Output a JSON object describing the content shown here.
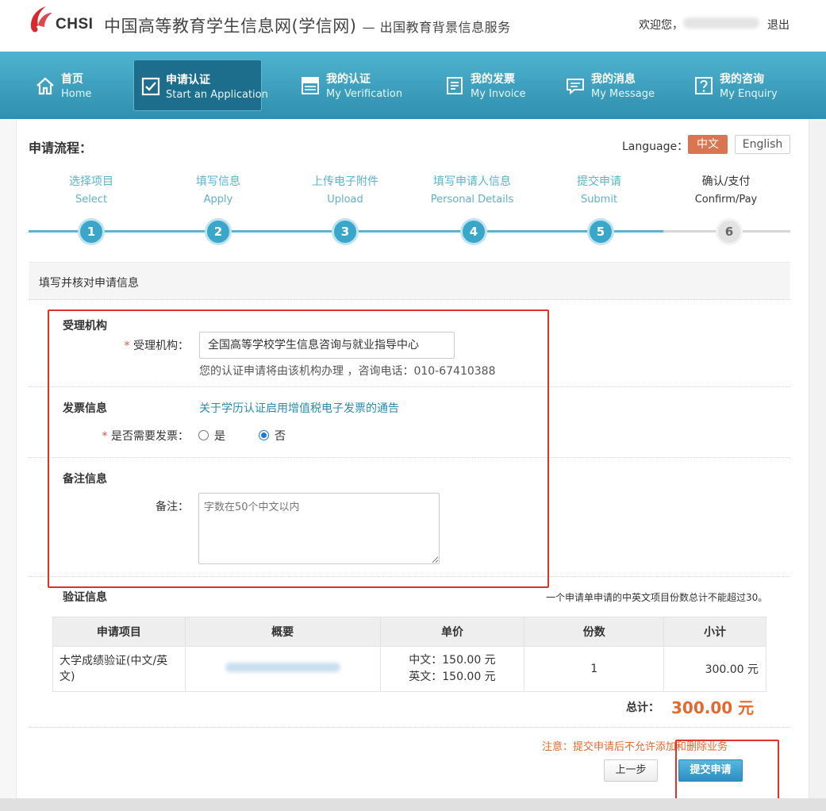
{
  "header": {
    "logo_text": "CHSI",
    "site_title": "中国高等教育学生信息网(学信网)",
    "site_subtitle": "— 出国教育背景信息服务",
    "welcome": "欢迎您，",
    "logout": "退出"
  },
  "nav": [
    {
      "zh": "首页",
      "en": "Home",
      "icon": "home-icon"
    },
    {
      "zh": "申请认证",
      "en": "Start an Application",
      "icon": "checkbox-icon",
      "active": true
    },
    {
      "zh": "我的认证",
      "en": "My Verification",
      "icon": "certificate-icon"
    },
    {
      "zh": "我的发票",
      "en": "My Invoice",
      "icon": "invoice-icon"
    },
    {
      "zh": "我的消息",
      "en": "My Message",
      "icon": "message-icon"
    },
    {
      "zh": "我的咨询",
      "en": "My Enquiry",
      "icon": "question-icon"
    }
  ],
  "process": {
    "title": "申请流程：",
    "language_label": "Language：",
    "lang_zh": "中文",
    "lang_en": "English",
    "steps": [
      {
        "zh": "选择项目",
        "en": "Select",
        "num": "1"
      },
      {
        "zh": "填写信息",
        "en": "Apply",
        "num": "2"
      },
      {
        "zh": "上传电子附件",
        "en": "Upload",
        "num": "3"
      },
      {
        "zh": "填写申请人信息",
        "en": "Personal Details",
        "num": "4"
      },
      {
        "zh": "提交申请",
        "en": "Submit",
        "num": "5"
      },
      {
        "zh": "确认/支付",
        "en": "Confirm/Pay",
        "num": "6"
      }
    ],
    "current_step": 6
  },
  "form": {
    "section_title": "填写并核对申请信息",
    "agency": {
      "title": "受理机构",
      "label": "受理机构：",
      "value": "全国高等学校学生信息咨询与就业指导中心",
      "hint": "您的认证申请将由该机构办理 ，咨询电话：010-67410388"
    },
    "invoice": {
      "title": "发票信息",
      "notice_link": "关于学历认证启用增值税电子发票的通告",
      "label": "是否需要发票：",
      "option_yes": "是",
      "option_no": "否",
      "selected": "否"
    },
    "remark": {
      "title": "备注信息",
      "label": "备注：",
      "placeholder": "字数在50个中文以内"
    }
  },
  "verification": {
    "title": "验证信息",
    "note": "一个申请单申请的中英文项目份数总计不能超过30。",
    "columns": [
      "申请项目",
      "概要",
      "单价",
      "份数",
      "小计"
    ],
    "rows": [
      {
        "item": "大学成绩验证(中文/英文)",
        "price_zh": "中文：150.00 元",
        "price_en": "英文：150.00 元",
        "quantity": "1",
        "subtotal": "300.00 元"
      }
    ],
    "total_label": "总计：",
    "total_value": "300.00 元"
  },
  "footer": {
    "warning": "注意：提交申请后不允许添加和删除业务",
    "prev_button": "上一步",
    "submit_button": "提交申请"
  },
  "colors": {
    "nav": "#3fa3c3",
    "accent_orange": "#e5692e",
    "highlight_red": "#e0312b"
  }
}
